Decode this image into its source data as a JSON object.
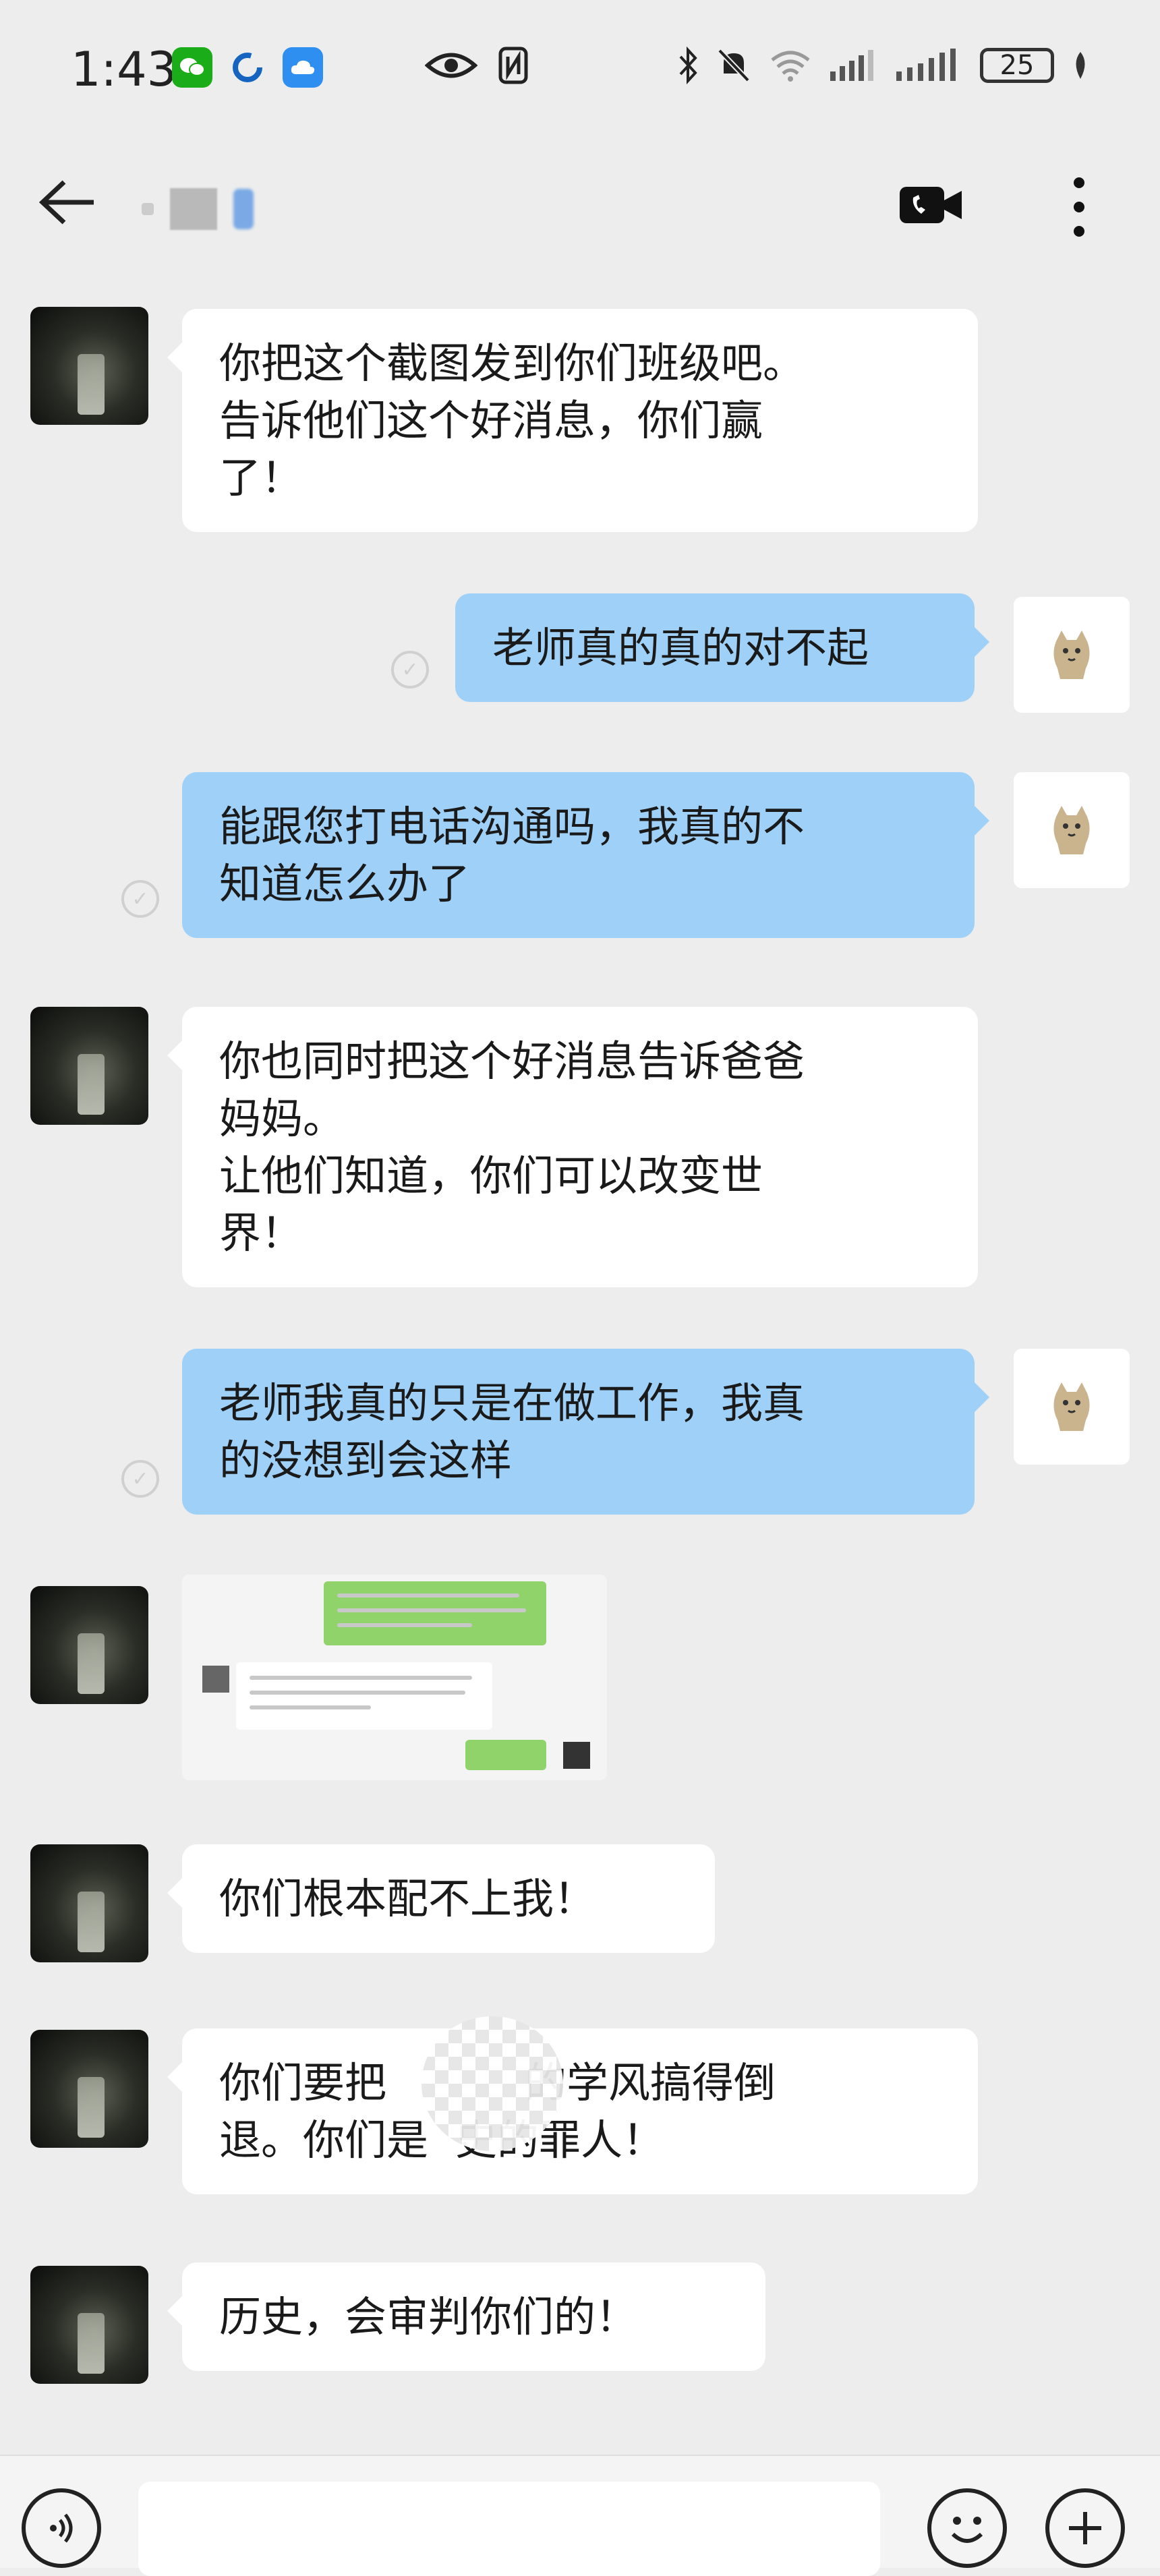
{
  "status_bar": {
    "time": "1:43",
    "battery": "25"
  },
  "header": {
    "back_icon": "arrow-left-icon",
    "video_icon": "video-call-icon",
    "more_icon": "more-vertical-icon"
  },
  "messages": [
    {
      "side": "in",
      "text": "你把这个截图发到你们班级吧。告诉他们这个好消息，你们赢了！",
      "lines": [
        "你把这个截图发到你们班级吧。",
        "告诉他们这个好消息，你们赢",
        "了！"
      ]
    },
    {
      "side": "out",
      "text": "老师真的真的对不起",
      "lines": [
        "老师真的真的对不起"
      ]
    },
    {
      "side": "out",
      "text": "能跟您打电话沟通吗，我真的不知道怎么办了",
      "lines": [
        "能跟您打电话沟通吗，我真的不",
        "知道怎么办了"
      ]
    },
    {
      "side": "in",
      "text": "你也同时把这个好消息告诉爸爸妈妈。让他们知道，你们可以改变世界！",
      "lines": [
        "你也同时把这个好消息告诉爸爸",
        "妈妈。",
        "让他们知道，你们可以改变世",
        "界！"
      ]
    },
    {
      "side": "out",
      "text": "老师我真的只是在做工作，我真的没想到会这样",
      "lines": [
        "老师我真的只是在做工作，我真",
        "的没想到会这样"
      ]
    },
    {
      "side": "in",
      "type": "image",
      "text": ""
    },
    {
      "side": "in",
      "text": "你们根本配不上我！",
      "lines": [
        "你们根本配不上我！"
      ]
    },
    {
      "side": "in",
      "text": "你们要把的学风搞得倒退。你们是史的罪人！",
      "lines": [
        "你们要把",
        "的学风搞得倒",
        "退。你们是",
        "史的罪人！"
      ]
    },
    {
      "side": "in",
      "text": "历史，会审判你们的！",
      "lines": [
        "历史，会审判你们的！"
      ]
    }
  ],
  "input_bar": {
    "voice_icon": "voice-icon",
    "emoji_icon": "emoji-icon",
    "plus_icon": "plus-icon"
  },
  "colors": {
    "background": "#ededed",
    "bubble_in": "#ffffff",
    "bubble_out": "#9fd0f7"
  }
}
